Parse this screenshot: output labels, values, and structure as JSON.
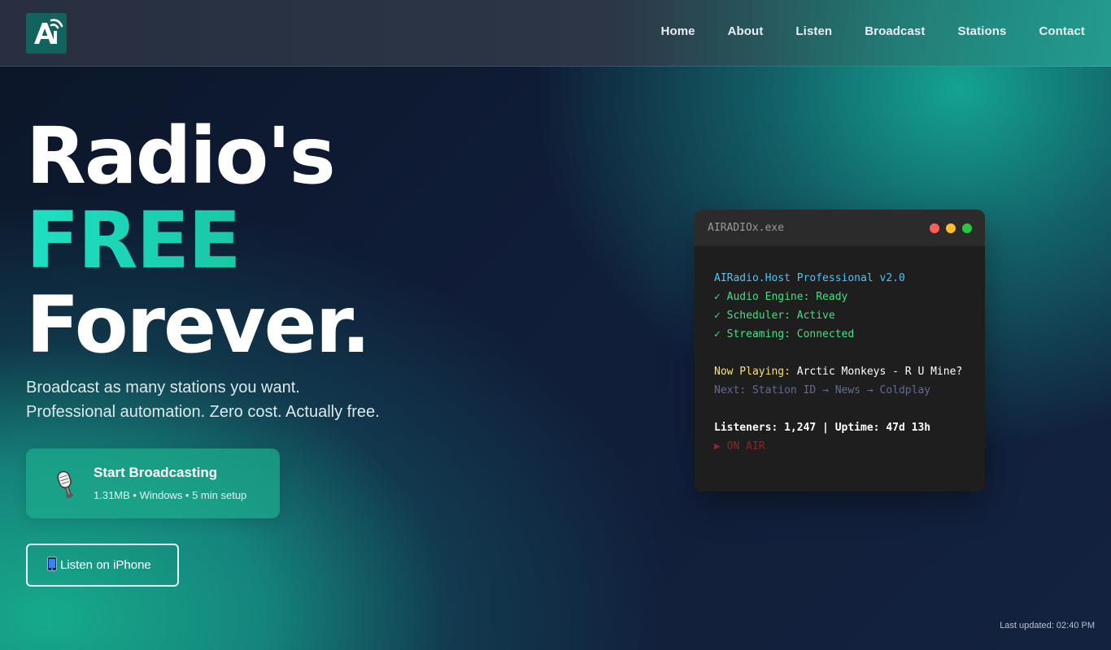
{
  "nav": {
    "logo_text": "AI",
    "links": [
      "Home",
      "About",
      "Listen",
      "Broadcast",
      "Stations",
      "Contact"
    ]
  },
  "hero": {
    "title_line1": "Radio's",
    "title_line2": "FREE",
    "title_line3": "Forever.",
    "subtitle_line1": "Broadcast as many stations you want.",
    "subtitle_line2": "Professional automation. Zero cost. Actually free."
  },
  "cta": {
    "primary_icon": "microphone-icon",
    "primary_title": "Start Broadcasting",
    "primary_meta": "1.31MB • Windows • 5 min setup",
    "secondary_icon": "mobile-phone-icon",
    "secondary_label": "Listen on iPhone"
  },
  "terminal": {
    "window_title": "AIRADIOx.exe",
    "product": "AIRadio.Host Professional v2.0",
    "checks": [
      "✓ Audio Engine: Ready",
      "✓ Scheduler: Active",
      "✓ Streaming: Connected"
    ],
    "now_playing_label": "Now Playing:",
    "now_playing_value": " Arctic Monkeys - R U Mine?",
    "next": "Next: Station ID → News → Coldplay",
    "stats": "Listeners: 1,247 | Uptime: 47d 13h",
    "status": "▶ ON AIR"
  },
  "footer": {
    "last_updated": "Last updated: 02:40 PM"
  },
  "colors": {
    "accent": "#1fe0c4",
    "terminal_bg": "#1e1e1e",
    "dot_red": "#ff5f56",
    "dot_yellow": "#ffbd2e",
    "dot_green": "#27c93f"
  }
}
